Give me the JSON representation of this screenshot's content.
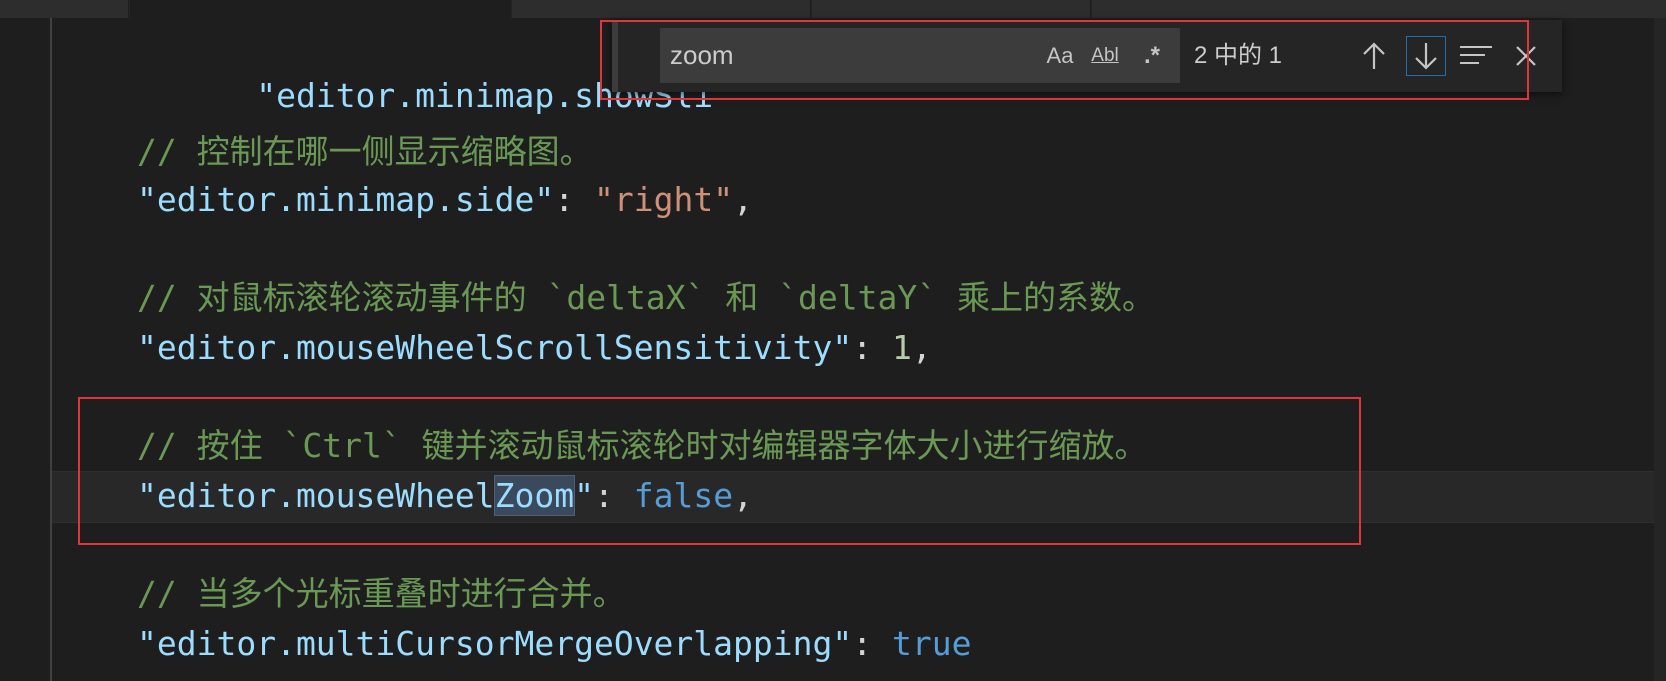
{
  "editor": {
    "lines": [
      {
        "type": "setting",
        "key": "\"editor.minimap.showSli",
        "after": ""
      },
      {
        "type": "comment",
        "text": "// 控制在哪一侧显示缩略图。"
      },
      {
        "type": "setting",
        "key": "\"editor.minimap.side\"",
        "colon": ": ",
        "value": "\"right\"",
        "comma": ","
      },
      {
        "type": "comment",
        "text": "// 对鼠标滚轮滚动事件的 `deltaX` 和 `deltaY` 乘上的系数。"
      },
      {
        "type": "setting",
        "key": "\"editor.mouseWheelScrollSensitivity\"",
        "colon": ": ",
        "value": "1",
        "comma": ","
      },
      {
        "type": "comment",
        "text": "// 按住 `Ctrl` 键并滚动鼠标滚轮时对编辑器字体大小进行缩放。"
      },
      {
        "type": "setting",
        "key_pre": "\"editor.mouseWheel",
        "key_match": "Zoom",
        "key_post": "\"",
        "colon": ": ",
        "value": "false",
        "comma": ","
      },
      {
        "type": "comment",
        "text": "// 当多个光标重叠时进行合并。"
      },
      {
        "type": "setting",
        "key": "\"editor.multiCursorMergeOverlapping\"",
        "colon": ": ",
        "value": "true"
      }
    ]
  },
  "find_widget": {
    "query": "zoom",
    "match_case_label": "Aa",
    "whole_word_label": "Abl",
    "regex_label": ".*",
    "match_count": "2 中的 1",
    "prev_icon": "arrow-up-icon",
    "next_icon": "arrow-down-icon",
    "selection_icon": "find-in-selection-icon",
    "close_icon": "close-icon"
  },
  "colors": {
    "background": "#1e1e1e",
    "comment": "#6a9955",
    "key": "#9cdcfe",
    "string": "#ce9178",
    "number": "#b5cea8",
    "keyword": "#569cd6",
    "annotation": "#e0353a"
  }
}
